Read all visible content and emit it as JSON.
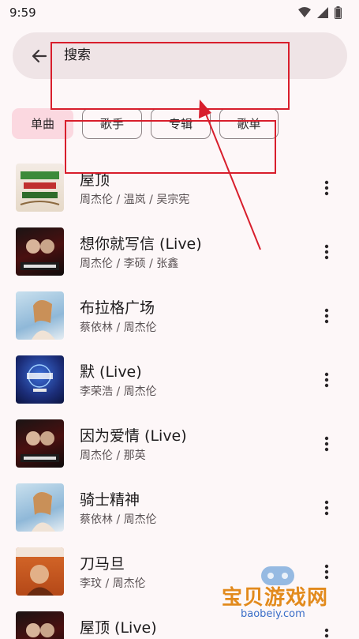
{
  "status": {
    "time": "9:59",
    "icons": [
      "wifi-icon",
      "signal-icon",
      "battery-icon"
    ]
  },
  "search": {
    "query": "搜索"
  },
  "tabs": [
    {
      "label": "单曲",
      "active": true
    },
    {
      "label": "歌手",
      "active": false
    },
    {
      "label": "专辑",
      "active": false
    },
    {
      "label": "歌单",
      "active": false
    }
  ],
  "songs": [
    {
      "title": "屋顶",
      "artists": "周杰伦 / 温岚 / 吴宗宪"
    },
    {
      "title": "想你就写信 (Live)",
      "artists": "周杰伦 / 李硕 / 张鑫"
    },
    {
      "title": "布拉格广场",
      "artists": "蔡依林 / 周杰伦"
    },
    {
      "title": "默 (Live)",
      "artists": "李荣浩 / 周杰伦"
    },
    {
      "title": "因为爱情 (Live)",
      "artists": "周杰伦 / 那英"
    },
    {
      "title": "骑士精神",
      "artists": "蔡依林 / 周杰伦"
    },
    {
      "title": "刀马旦",
      "artists": "李玟 / 周杰伦"
    },
    {
      "title": "屋顶 (Live)",
      "artists": ""
    }
  ],
  "watermark": {
    "name": "宝贝游戏网",
    "url": "baobeiy.com"
  },
  "colors": {
    "accent_chip": "#fbd8e0",
    "search_bg": "#efe4e6",
    "annotation": "#d81e2c"
  }
}
